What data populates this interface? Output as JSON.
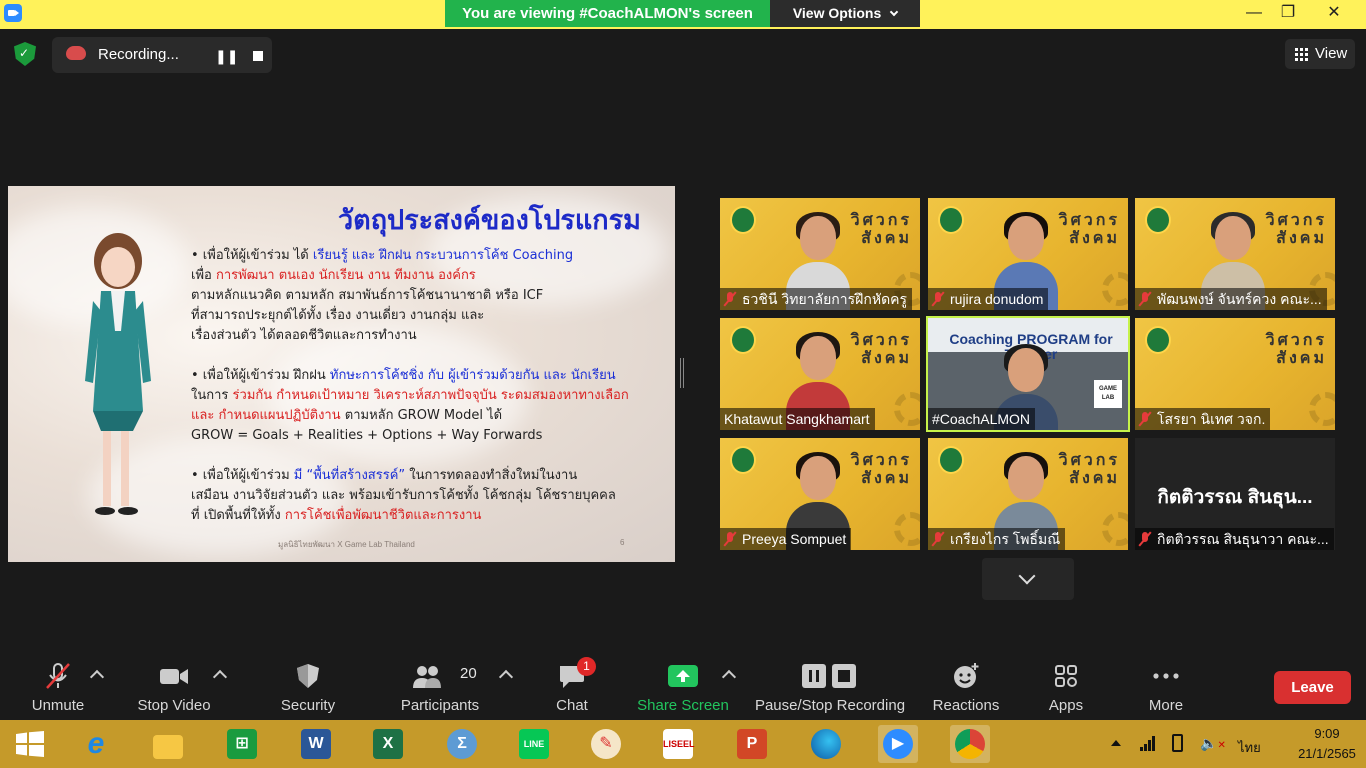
{
  "window": {
    "banner": "You are viewing #CoachALMON's screen",
    "view_options": "View Options",
    "minimize": "—",
    "maximize": "❐",
    "close": "✕"
  },
  "recording": {
    "label": "Recording...",
    "pause": "❚❚"
  },
  "view_button": "View",
  "slide": {
    "title": "วัตถุประสงค์ของโปรแกรม",
    "p1": [
      {
        "t": "• เพื่อให้ผู้เข้าร่วม ได้ ",
        "c": ""
      },
      {
        "t": "เรียนรู้ และ ฝึกฝน กระบวนการโค้ช Coaching",
        "c": "blue"
      },
      {
        "t": "\nเพื่อ ",
        "c": ""
      },
      {
        "t": "การพัฒนา ตนเอง นักเรียน งาน ทีมงาน องค์กร",
        "c": "red"
      },
      {
        "t": "\nตามหลักแนวคิด ตามหลัก สมาพันธ์การโค้ชนานาชาติ หรือ ICF\nที่สามารถประยุกต์ได้ทั้ง เรื่อง งานเดี่ยว งานกลุ่ม และ\nเรื่องส่วนตัว ได้ตลอดชีวิตและการทำงาน",
        "c": ""
      }
    ],
    "p2": [
      {
        "t": "• เพื่อให้ผู้เข้าร่วม ฝึกฝน ",
        "c": ""
      },
      {
        "t": "ทักษะการโค้ชชิ่ง กับ ผู้เข้าร่วมด้วยกัน และ นักเรียน",
        "c": "blue"
      },
      {
        "t": "\nในการ ",
        "c": ""
      },
      {
        "t": "ร่วมกัน กำหนดเป้าหมาย วิเคราะห์สภาพปัจจุบัน ระดมสมองหาทางเลือก\nและ กำหนดแผนปฏิบัติงาน",
        "c": "red"
      },
      {
        "t": " ตามหลัก GROW Model ได้\nGROW = Goals + Realities + Options + Way Forwards",
        "c": ""
      }
    ],
    "p3": [
      {
        "t": "• เพื่อให้ผู้เข้าร่วม ",
        "c": ""
      },
      {
        "t": "มี “พื้นที่สร้างสรรค์”",
        "c": "blue"
      },
      {
        "t": " ในการทดลองทำสิ่งใหม่ในงาน\nเสมือน งานวิจัยส่วนตัว และ พร้อมเข้ารับการโค้ชทั้ง โค้ชกลุ่ม โค้ชรายบุคคล\nที่ เปิดพื้นที่ให้ทั้ง ",
        "c": ""
      },
      {
        "t": "การโค้ชเพื่อพัฒนาชีวิตและการงาน",
        "c": "red"
      }
    ],
    "footer": "มูลนิธิไทยพัฒนา X Game Lab Thailand",
    "page": "6"
  },
  "participants": [
    {
      "name": "ธวชินี  วิทยาลัยการฝึกหัดครู",
      "muted": true,
      "shirt": "#d9d9d9",
      "hair": "#2a1d14"
    },
    {
      "name": "rujira donudom",
      "muted": true,
      "shirt": "#5a79b5",
      "hair": "#140e0b"
    },
    {
      "name": "พัฒนพงษ์ จันทร์ควง คณะ...",
      "muted": true,
      "shirt": "#cdbfa6",
      "hair": "#2b2b2b"
    },
    {
      "name": "Khatawut Sangkhamart",
      "muted": false,
      "shirt": "#c23a3a",
      "hair": "#1d1712"
    },
    {
      "name": "#CoachALMON",
      "muted": false,
      "shirt": "#3a4d6b",
      "hair": "#1a1a1a",
      "overlay": "Coaching PROGRAM for Teacher",
      "lab": "GAME LAB"
    },
    {
      "name": "โสรยา นิเทศ วจก.",
      "muted": true,
      "shirt": "",
      "hair": ""
    },
    {
      "name": "Preeya Sompuet",
      "muted": true,
      "shirt": "#3a3a3a",
      "hair": "#1a120c"
    },
    {
      "name": "เกรียงไกร โพธิ์มณี",
      "muted": true,
      "shirt": "#7a8a9a",
      "hair": "#15100d"
    },
    {
      "name": "กิตติวรรณ สินธุนาวา คณะ...",
      "muted": true,
      "big": "กิตติวรรณ สินธุน..."
    }
  ],
  "tile_brand": "วิศวกร\nสังคม",
  "toolbar": {
    "unmute": "Unmute",
    "stop_video": "Stop Video",
    "security": "Security",
    "participants": "Participants",
    "participant_count": "20",
    "chat": "Chat",
    "chat_badge": "1",
    "share_screen": "Share Screen",
    "pause_recording": "Pause/Stop Recording",
    "reactions": "Reactions",
    "apps": "Apps",
    "more": "More",
    "leave": "Leave"
  },
  "taskbar": {
    "time": "9:09",
    "date": "21/1/2565",
    "lang": "ไทย",
    "liseel": "LISEEL"
  },
  "colors": {
    "banner_green": "#22b34c",
    "top_yellow": "#fff25a",
    "tile_yellow": "#e9b937",
    "leave_red": "#d93030",
    "share_green": "#22c55e",
    "taskbar": "#c59a2a"
  }
}
